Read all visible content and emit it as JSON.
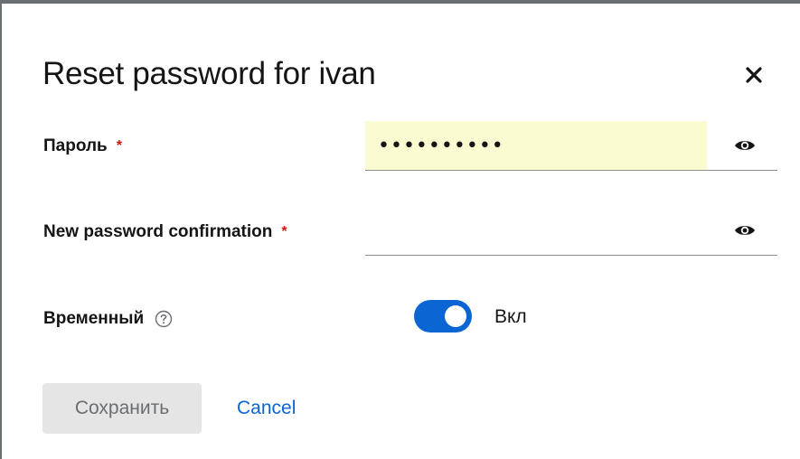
{
  "dialog": {
    "title": "Reset password for ivan",
    "close_icon": "close-icon"
  },
  "password": {
    "label": "Пароль",
    "required_mark": "*",
    "value": "••••••••••",
    "eye_icon": "eye-icon"
  },
  "confirmation": {
    "label": "New password confirmation",
    "required_mark": "*",
    "value": "",
    "eye_icon": "eye-icon"
  },
  "temporary": {
    "label": "Временный",
    "help_icon": "question-circle-icon",
    "switch_on": true,
    "switch_text": "Вкл"
  },
  "actions": {
    "save_label": "Сохранить",
    "cancel_label": "Cancel"
  },
  "colors": {
    "accent": "#0b66d4",
    "required": "#c9190b",
    "autofill_bg": "#fbfbd1",
    "disabled_bg": "#e5e5e5"
  }
}
